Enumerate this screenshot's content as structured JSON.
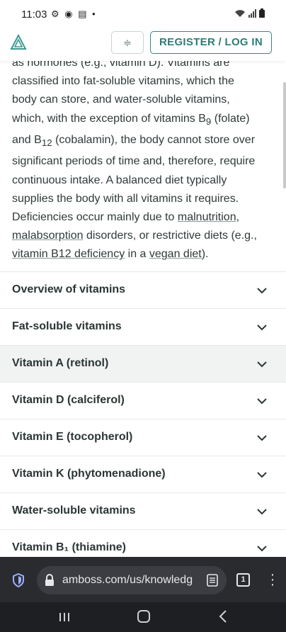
{
  "status_bar": {
    "time": "11:03",
    "icons": [
      "gear-icon",
      "media-icon",
      "calendar-icon",
      "dot-icon"
    ],
    "right_icons": [
      "wifi-icon",
      "signal-icon",
      "battery-icon"
    ]
  },
  "header": {
    "collapse_symbol": "≑",
    "register_label": "REGISTER / LOG IN",
    "accent_color": "#2f8a80"
  },
  "article": {
    "p_line0": "as hormones (e.g., vitamin D). Vitamins are",
    "p_l1": "classified into fat-soluble vitamins, which the",
    "p_l2": "body can store, and water-soluble vitamins,",
    "p_l3a": "which, with the exception of vitamins B",
    "p_l3sub": "9",
    "p_l3b": " (folate)",
    "p_l4a": "and B",
    "p_l4sub": "12",
    "p_l4b": " (cobalamin), the body cannot store over",
    "p_l5": "significant periods of time and, therefore, require",
    "p_l6": "continuous intake. A balanced diet typically",
    "p_l7": "supplies the body with all vitamins it requires.",
    "p_l8a": "Deficiencies occur mainly due to ",
    "p_l8link": "malnutrition",
    "p_l8b": ",",
    "p_l9link": "malabsorption",
    "p_l9b": " disorders, or restrictive diets (e.g.,",
    "p_l10link1": "vitamin B12 deficiency",
    "p_l10mid": " in a ",
    "p_l10link2": "vegan diet",
    "p_l10end": ")."
  },
  "sections": [
    {
      "label": "Overview of vitamins"
    },
    {
      "label": "Fat-soluble vitamins"
    },
    {
      "label": "Vitamin A (retinol)"
    },
    {
      "label": "Vitamin D (calciferol)"
    },
    {
      "label": "Vitamin E (tocopherol)"
    },
    {
      "label": "Vitamin K (phytomenadione)"
    },
    {
      "label": "Water-soluble vitamins"
    },
    {
      "label": "Vitamin B₁ (thiamine)"
    }
  ],
  "browser": {
    "url": "amboss.com/us/knowledg",
    "tab_count": "1"
  }
}
